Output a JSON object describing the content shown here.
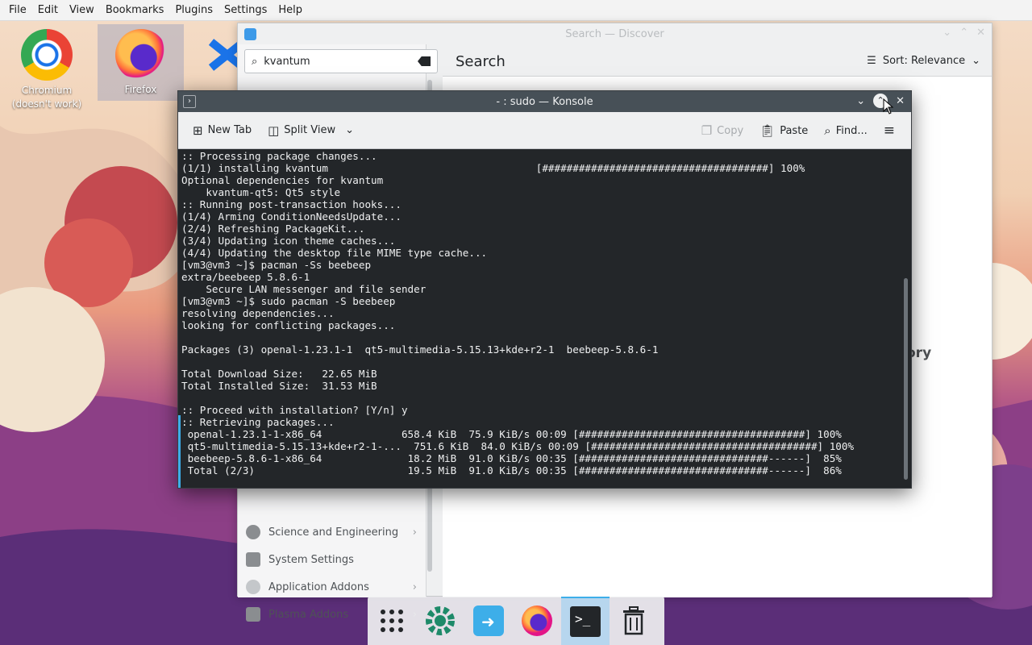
{
  "menubar": {
    "items": [
      "File",
      "Edit",
      "View",
      "Bookmarks",
      "Plugins",
      "Settings",
      "Help"
    ]
  },
  "desktop": {
    "icons": [
      {
        "label": "Chromium\n(doesn't work)",
        "icon": "chromium-icon"
      },
      {
        "label": "Firefox",
        "icon": "firefox-icon"
      }
    ]
  },
  "discover": {
    "window_title": "Search — Discover",
    "search_value": "kvantum",
    "page_title": "Search",
    "sort_label": "Sort: Relevance",
    "partial_text": "ory",
    "categories": [
      {
        "label": "Science and Engineering",
        "has_arrow": true
      },
      {
        "label": "System Settings",
        "has_arrow": false
      },
      {
        "label": "Application Addons",
        "has_arrow": true
      },
      {
        "label": "Plasma Addons",
        "has_arrow": true
      }
    ]
  },
  "konsole": {
    "window_title": "- : sudo — Konsole",
    "toolbar": {
      "new_tab": "New Tab",
      "split_view": "Split View",
      "copy": "Copy",
      "paste": "Paste",
      "find": "Find..."
    },
    "lines": [
      ":: Processing package changes...",
      "(1/1) installing kvantum                                  [#####################################] 100%",
      "Optional dependencies for kvantum",
      "    kvantum-qt5: Qt5 style",
      ":: Running post-transaction hooks...",
      "(1/4) Arming ConditionNeedsUpdate...",
      "(2/4) Refreshing PackageKit...",
      "(3/4) Updating icon theme caches...",
      "(4/4) Updating the desktop file MIME type cache...",
      "[vm3@vm3 ~]$ pacman -Ss beebeep",
      "extra/beebeep 5.8.6-1",
      "    Secure LAN messenger and file sender",
      "[vm3@vm3 ~]$ sudo pacman -S beebeep",
      "resolving dependencies...",
      "looking for conflicting packages...",
      "",
      "Packages (3) openal-1.23.1-1  qt5-multimedia-5.15.13+kde+r2-1  beebeep-5.8.6-1",
      "",
      "Total Download Size:   22.65 MiB",
      "Total Installed Size:  31.53 MiB",
      "",
      ":: Proceed with installation? [Y/n] y",
      ":: Retrieving packages...",
      " openal-1.23.1-1-x86_64             658.4 KiB  75.9 KiB/s 00:09 [#####################################] 100%",
      " qt5-multimedia-5.15.13+kde+r2-1-...  751.6 KiB  84.0 KiB/s 00:09 [#####################################] 100%",
      " beebeep-5.8.6-1-x86_64              18.2 MiB  91.0 KiB/s 00:35 [###############################------]  85%",
      " Total (2/3)                         19.5 MiB  91.0 KiB/s 00:35 [###############################------]  86%"
    ]
  },
  "dock": {
    "items": [
      "app-launcher-icon",
      "settings-icon",
      "discover-icon",
      "firefox-icon",
      "konsole-icon",
      "trash-icon"
    ],
    "active": "konsole-icon"
  }
}
